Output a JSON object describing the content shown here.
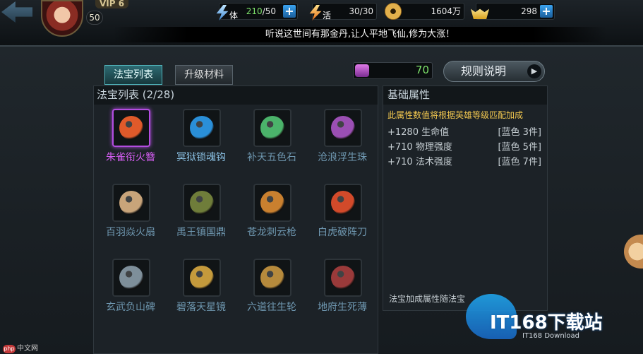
{
  "header": {
    "vip_label": "VIP 6",
    "level": "50",
    "stamina": {
      "label": "体",
      "current": "210",
      "max": "/50"
    },
    "vitality": {
      "label": "活",
      "value": "30/30"
    },
    "coins": "1604万",
    "ingots": "298",
    "marquee": "听说这世间有那金丹,让人平地飞仙,修为大涨！"
  },
  "tabs": [
    {
      "label": "法宝列表",
      "active": true
    },
    {
      "label": "升级材料",
      "active": false
    }
  ],
  "currency_gem": "70",
  "rules_button": "规则说明",
  "list": {
    "title": "法宝列表 (2/28)",
    "items": [
      {
        "name": "朱雀衔火簪",
        "state": "selected",
        "color": "#e05a2a"
      },
      {
        "name": "冥狱锁魂钩",
        "state": "owned",
        "color": "#2a8fd8"
      },
      {
        "name": "补天五色石",
        "state": "locked",
        "color": "#4bb36a"
      },
      {
        "name": "沧浪浮生珠",
        "state": "locked",
        "color": "#9b4fb3"
      },
      {
        "name": "百羽焱火扇",
        "state": "locked",
        "color": "#c8a47a"
      },
      {
        "name": "禹王镇国鼎",
        "state": "locked",
        "color": "#6f7d3a"
      },
      {
        "name": "苍龙刺云枪",
        "state": "locked",
        "color": "#c9802f"
      },
      {
        "name": "白虎破阵刀",
        "state": "locked",
        "color": "#d24a2a"
      },
      {
        "name": "玄武负山碑",
        "state": "locked",
        "color": "#7e8f9a"
      },
      {
        "name": "碧落天星镜",
        "state": "locked",
        "color": "#c49a3c"
      },
      {
        "name": "六道往生轮",
        "state": "locked",
        "color": "#b68a3c"
      },
      {
        "name": "地府生死薄",
        "state": "locked",
        "color": "#9a3a3a"
      }
    ]
  },
  "attributes": {
    "title": "基础属性",
    "note": "此属性数值将根据英雄等级匹配加成",
    "rows": [
      {
        "stat": "+1280 生命值",
        "req": "[蓝色 3件]"
      },
      {
        "stat": "+710 物理强度",
        "req": "[蓝色 5件]"
      },
      {
        "stat": "+710 法术强度",
        "req": "[蓝色 7件]"
      }
    ],
    "footer": "法宝加成属性随法宝"
  },
  "watermark": {
    "logo": "IT168下载站",
    "sub": "IT168 Download"
  },
  "php_mark": {
    "logo": "php",
    "text": "中文网"
  }
}
